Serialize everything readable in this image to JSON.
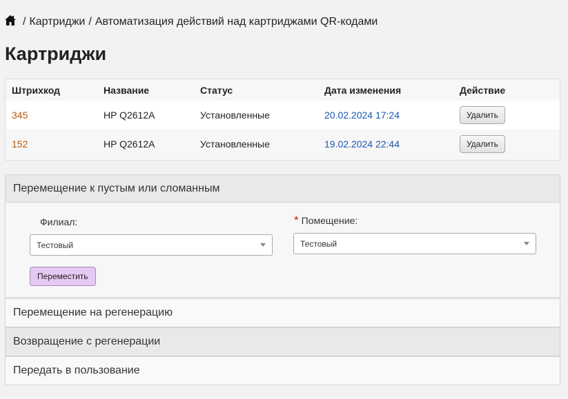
{
  "breadcrumb": {
    "home_icon": "home-icon",
    "separator": "/",
    "items": [
      "Картриджи",
      "Автоматизация действий над картриджами QR-кодами"
    ]
  },
  "page_title": "Картриджи",
  "table": {
    "headers": [
      "Штрихкод",
      "Название",
      "Статус",
      "Дата изменения",
      "Действие"
    ],
    "rows": [
      {
        "barcode": "345",
        "name": "HP Q2612A",
        "status": "Установленные",
        "date": "20.02.2024 17:24",
        "action": "Удалить"
      },
      {
        "barcode": "152",
        "name": "HP Q2612A",
        "status": "Установленные",
        "date": "19.02.2024 22:44",
        "action": "Удалить"
      }
    ]
  },
  "panels": {
    "move_empty": {
      "title": "Перемещение к пустым или сломанным",
      "branch_label": "Филиал:",
      "branch_value": "Тестовый",
      "room_required_mark": "*",
      "room_label": "Помещение:",
      "room_value": "Тестовый",
      "submit_label": "Переместить"
    },
    "to_regeneration": {
      "title": "Перемещение на регенерацию"
    },
    "from_regeneration": {
      "title": "Возвращение с регенерации"
    },
    "to_use": {
      "title": "Передать в пользование"
    }
  },
  "colors": {
    "barcode_link": "#b8590a",
    "date_link": "#1a55b0",
    "required": "#d21919",
    "move_button": "#e4c9f2"
  }
}
